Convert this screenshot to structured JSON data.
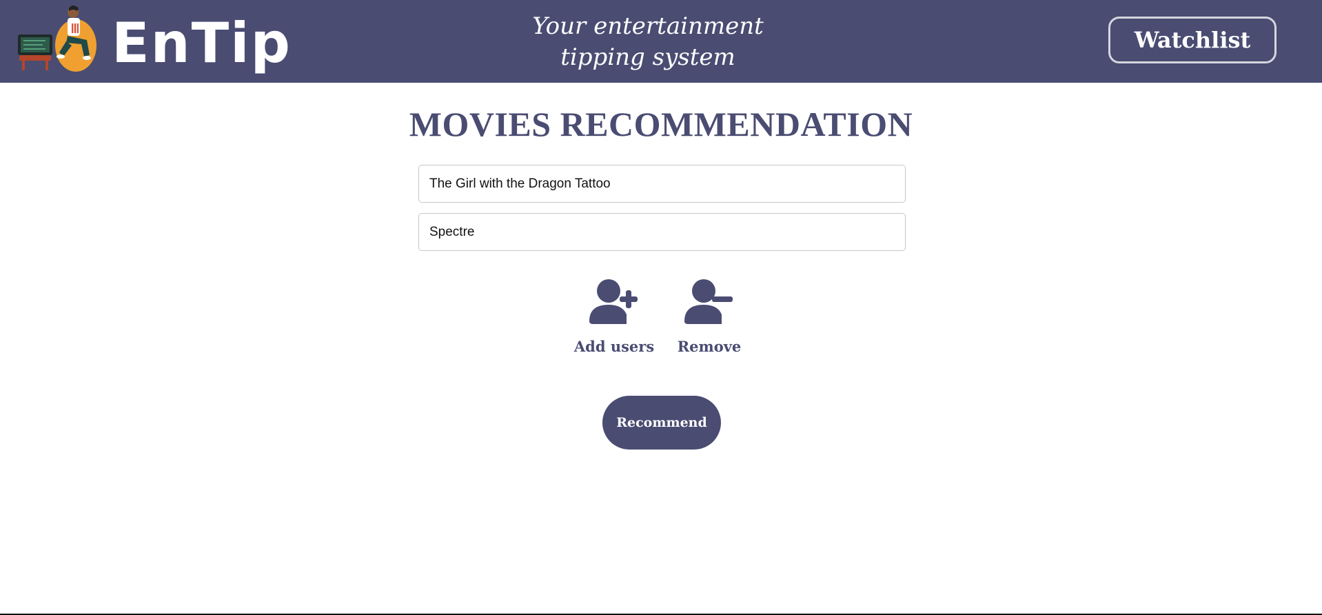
{
  "header": {
    "brand": "EnTip",
    "tagline_line1": "Your entertainment",
    "tagline_line2": "tipping system",
    "watchlist_label": "Watchlist",
    "logo_icon": "person-on-beanbag-watching-tv-icon"
  },
  "main": {
    "title": "MOVIES RECOMMENDATION",
    "inputs": [
      {
        "value": "The Girl with the Dragon Tattoo"
      },
      {
        "value": "Spectre"
      }
    ],
    "add_users": {
      "label": "Add users",
      "icon": "user-plus-icon"
    },
    "remove": {
      "label": "Remove",
      "icon": "user-minus-icon"
    },
    "recommend_label": "Recommend"
  },
  "colors": {
    "brand": "#4a4c72",
    "header_text": "#ffffff",
    "accent_orange": "#f0a030"
  }
}
